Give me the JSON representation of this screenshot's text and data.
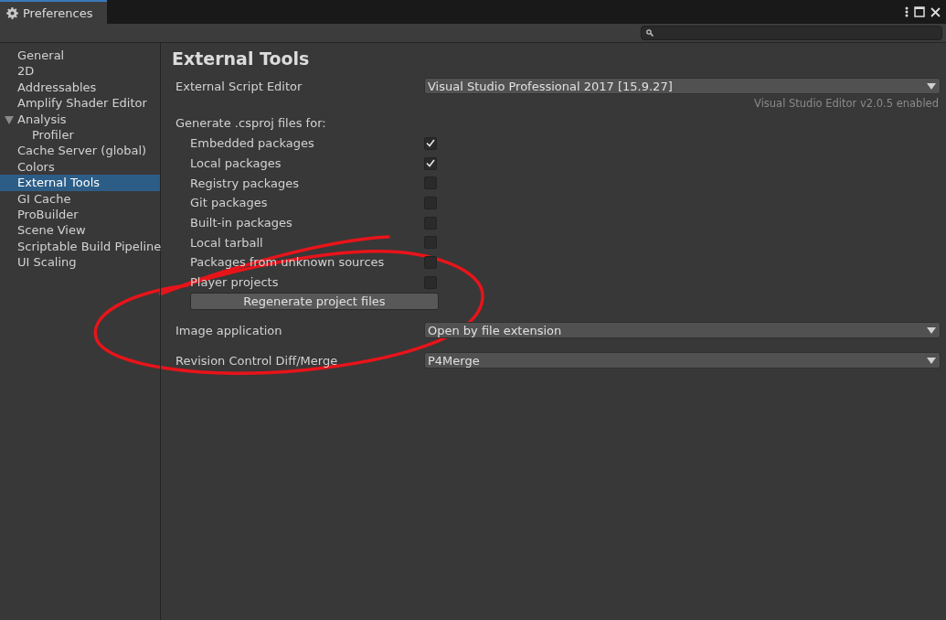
{
  "window": {
    "title": "Preferences"
  },
  "sidebar": {
    "items": [
      {
        "label": "General",
        "selected": false
      },
      {
        "label": "2D",
        "selected": false
      },
      {
        "label": "Addressables",
        "selected": false
      },
      {
        "label": "Amplify Shader Editor",
        "selected": false
      },
      {
        "label": "Analysis",
        "selected": false,
        "expanded": true,
        "children": [
          {
            "label": "Profiler",
            "selected": false
          }
        ]
      },
      {
        "label": "Cache Server (global)",
        "selected": false
      },
      {
        "label": "Colors",
        "selected": false
      },
      {
        "label": "External Tools",
        "selected": true
      },
      {
        "label": "GI Cache",
        "selected": false
      },
      {
        "label": "ProBuilder",
        "selected": false
      },
      {
        "label": "Scene View",
        "selected": false
      },
      {
        "label": "Scriptable Build Pipeline",
        "selected": false
      },
      {
        "label": "UI Scaling",
        "selected": false
      }
    ]
  },
  "page": {
    "title": "External Tools",
    "script_editor": {
      "label": "External Script Editor",
      "value": "Visual Studio Professional 2017 [15.9.27]",
      "note": "Visual Studio Editor v2.0.5 enabled"
    },
    "generate_label": "Generate .csproj files for:",
    "options": [
      {
        "label": "Embedded packages",
        "checked": true
      },
      {
        "label": "Local packages",
        "checked": true
      },
      {
        "label": "Registry packages",
        "checked": false
      },
      {
        "label": "Git packages",
        "checked": false
      },
      {
        "label": "Built-in packages",
        "checked": false
      },
      {
        "label": "Local tarball",
        "checked": false
      },
      {
        "label": "Packages from unknown sources",
        "checked": false
      },
      {
        "label": "Player projects",
        "checked": false
      }
    ],
    "regenerate_button": "Regenerate project files",
    "dropdowns": [
      {
        "label": "Image application",
        "value": "Open by file extension"
      },
      {
        "label": "Revision Control Diff/Merge",
        "value": "P4Merge"
      }
    ]
  }
}
